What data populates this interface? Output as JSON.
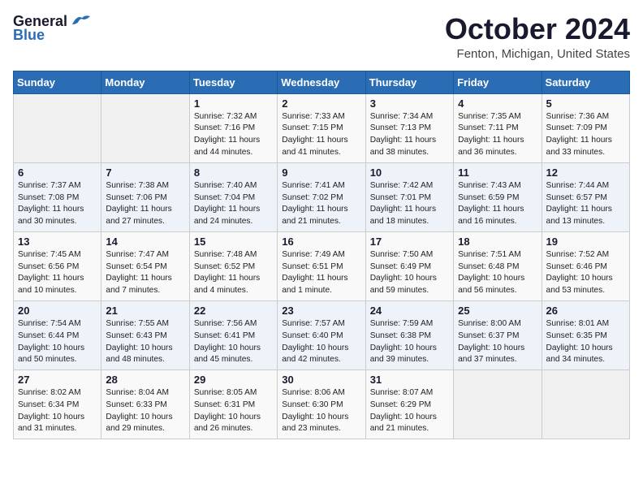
{
  "header": {
    "logo_general": "General",
    "logo_blue": "Blue",
    "month_title": "October 2024",
    "location": "Fenton, Michigan, United States"
  },
  "days_of_week": [
    "Sunday",
    "Monday",
    "Tuesday",
    "Wednesday",
    "Thursday",
    "Friday",
    "Saturday"
  ],
  "weeks": [
    [
      {
        "day": "",
        "info": ""
      },
      {
        "day": "",
        "info": ""
      },
      {
        "day": "1",
        "info": "Sunrise: 7:32 AM\nSunset: 7:16 PM\nDaylight: 11 hours and 44 minutes."
      },
      {
        "day": "2",
        "info": "Sunrise: 7:33 AM\nSunset: 7:15 PM\nDaylight: 11 hours and 41 minutes."
      },
      {
        "day": "3",
        "info": "Sunrise: 7:34 AM\nSunset: 7:13 PM\nDaylight: 11 hours and 38 minutes."
      },
      {
        "day": "4",
        "info": "Sunrise: 7:35 AM\nSunset: 7:11 PM\nDaylight: 11 hours and 36 minutes."
      },
      {
        "day": "5",
        "info": "Sunrise: 7:36 AM\nSunset: 7:09 PM\nDaylight: 11 hours and 33 minutes."
      }
    ],
    [
      {
        "day": "6",
        "info": "Sunrise: 7:37 AM\nSunset: 7:08 PM\nDaylight: 11 hours and 30 minutes."
      },
      {
        "day": "7",
        "info": "Sunrise: 7:38 AM\nSunset: 7:06 PM\nDaylight: 11 hours and 27 minutes."
      },
      {
        "day": "8",
        "info": "Sunrise: 7:40 AM\nSunset: 7:04 PM\nDaylight: 11 hours and 24 minutes."
      },
      {
        "day": "9",
        "info": "Sunrise: 7:41 AM\nSunset: 7:02 PM\nDaylight: 11 hours and 21 minutes."
      },
      {
        "day": "10",
        "info": "Sunrise: 7:42 AM\nSunset: 7:01 PM\nDaylight: 11 hours and 18 minutes."
      },
      {
        "day": "11",
        "info": "Sunrise: 7:43 AM\nSunset: 6:59 PM\nDaylight: 11 hours and 16 minutes."
      },
      {
        "day": "12",
        "info": "Sunrise: 7:44 AM\nSunset: 6:57 PM\nDaylight: 11 hours and 13 minutes."
      }
    ],
    [
      {
        "day": "13",
        "info": "Sunrise: 7:45 AM\nSunset: 6:56 PM\nDaylight: 11 hours and 10 minutes."
      },
      {
        "day": "14",
        "info": "Sunrise: 7:47 AM\nSunset: 6:54 PM\nDaylight: 11 hours and 7 minutes."
      },
      {
        "day": "15",
        "info": "Sunrise: 7:48 AM\nSunset: 6:52 PM\nDaylight: 11 hours and 4 minutes."
      },
      {
        "day": "16",
        "info": "Sunrise: 7:49 AM\nSunset: 6:51 PM\nDaylight: 11 hours and 1 minute."
      },
      {
        "day": "17",
        "info": "Sunrise: 7:50 AM\nSunset: 6:49 PM\nDaylight: 10 hours and 59 minutes."
      },
      {
        "day": "18",
        "info": "Sunrise: 7:51 AM\nSunset: 6:48 PM\nDaylight: 10 hours and 56 minutes."
      },
      {
        "day": "19",
        "info": "Sunrise: 7:52 AM\nSunset: 6:46 PM\nDaylight: 10 hours and 53 minutes."
      }
    ],
    [
      {
        "day": "20",
        "info": "Sunrise: 7:54 AM\nSunset: 6:44 PM\nDaylight: 10 hours and 50 minutes."
      },
      {
        "day": "21",
        "info": "Sunrise: 7:55 AM\nSunset: 6:43 PM\nDaylight: 10 hours and 48 minutes."
      },
      {
        "day": "22",
        "info": "Sunrise: 7:56 AM\nSunset: 6:41 PM\nDaylight: 10 hours and 45 minutes."
      },
      {
        "day": "23",
        "info": "Sunrise: 7:57 AM\nSunset: 6:40 PM\nDaylight: 10 hours and 42 minutes."
      },
      {
        "day": "24",
        "info": "Sunrise: 7:59 AM\nSunset: 6:38 PM\nDaylight: 10 hours and 39 minutes."
      },
      {
        "day": "25",
        "info": "Sunrise: 8:00 AM\nSunset: 6:37 PM\nDaylight: 10 hours and 37 minutes."
      },
      {
        "day": "26",
        "info": "Sunrise: 8:01 AM\nSunset: 6:35 PM\nDaylight: 10 hours and 34 minutes."
      }
    ],
    [
      {
        "day": "27",
        "info": "Sunrise: 8:02 AM\nSunset: 6:34 PM\nDaylight: 10 hours and 31 minutes."
      },
      {
        "day": "28",
        "info": "Sunrise: 8:04 AM\nSunset: 6:33 PM\nDaylight: 10 hours and 29 minutes."
      },
      {
        "day": "29",
        "info": "Sunrise: 8:05 AM\nSunset: 6:31 PM\nDaylight: 10 hours and 26 minutes."
      },
      {
        "day": "30",
        "info": "Sunrise: 8:06 AM\nSunset: 6:30 PM\nDaylight: 10 hours and 23 minutes."
      },
      {
        "day": "31",
        "info": "Sunrise: 8:07 AM\nSunset: 6:29 PM\nDaylight: 10 hours and 21 minutes."
      },
      {
        "day": "",
        "info": ""
      },
      {
        "day": "",
        "info": ""
      }
    ]
  ]
}
